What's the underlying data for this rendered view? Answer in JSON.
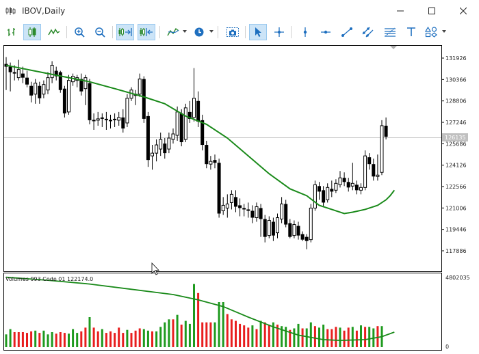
{
  "window": {
    "title": "IBOV,Daily"
  },
  "toolbar": {
    "items": [
      "period-separators",
      "bar-chart",
      "candlestick",
      "line-chart",
      "zoom-in",
      "zoom-out",
      "chart-shift",
      "auto-scroll",
      "indicators",
      "periodicity",
      "screenshot",
      "cursor",
      "crosshair",
      "vertical-line",
      "horizontal-line",
      "trendline",
      "channel",
      "fibonacci",
      "text",
      "shapes"
    ]
  },
  "chart": {
    "y_ticks": [
      "131926",
      "130366",
      "128806",
      "127246",
      "125686",
      "124126",
      "122566",
      "121006",
      "119446",
      "117886"
    ],
    "current_price_label": "126135",
    "candles": [
      [
        131.5,
        131.3,
        132.0,
        129.6
      ],
      [
        131.3,
        130.9,
        131.6,
        129.5
      ],
      [
        130.9,
        130.8,
        131.4,
        130.3
      ],
      [
        130.5,
        131.1,
        131.8,
        130.3
      ],
      [
        130.8,
        130.5,
        131.3,
        130.1
      ],
      [
        130.5,
        130.0,
        131.0,
        129.8
      ],
      [
        129.9,
        129.2,
        130.2,
        128.7
      ],
      [
        129.3,
        130.1,
        130.4,
        128.6
      ],
      [
        129.9,
        129.0,
        130.2,
        128.6
      ],
      [
        129.3,
        130.0,
        130.3,
        129.0
      ],
      [
        129.6,
        130.5,
        130.9,
        129.3
      ],
      [
        130.5,
        131.4,
        131.7,
        130.1
      ],
      [
        131.0,
        130.6,
        131.3,
        130.3
      ],
      [
        130.9,
        129.6,
        131.0,
        129.4
      ],
      [
        129.7,
        127.9,
        129.9,
        127.6
      ],
      [
        128.0,
        130.3,
        130.7,
        127.8
      ],
      [
        130.2,
        130.6,
        130.8,
        129.9
      ],
      [
        130.3,
        130.5,
        130.7,
        129.8
      ],
      [
        130.4,
        129.5,
        130.8,
        129.2
      ],
      [
        129.7,
        130.5,
        130.7,
        128.5
      ],
      [
        130.1,
        127.4,
        130.4,
        127.1
      ],
      [
        127.4,
        127.4,
        127.9,
        126.7
      ],
      [
        127.4,
        127.5,
        128.0,
        127.0
      ],
      [
        127.6,
        127.5,
        127.9,
        126.9
      ],
      [
        127.5,
        127.4,
        128.0,
        126.7
      ],
      [
        127.4,
        127.4,
        127.8,
        126.8
      ],
      [
        127.5,
        127.4,
        127.9,
        126.9
      ],
      [
        127.4,
        127.6,
        128.0,
        127.0
      ],
      [
        127.6,
        126.8,
        128.2,
        126.5
      ],
      [
        127.2,
        129.0,
        129.3,
        126.9
      ],
      [
        129.0,
        129.6,
        129.8,
        128.8
      ],
      [
        129.2,
        129.3,
        129.6,
        128.5
      ],
      [
        129.3,
        130.4,
        130.8,
        129.1
      ],
      [
        130.4,
        127.5,
        130.6,
        127.2
      ],
      [
        127.7,
        124.5,
        128.0,
        124.0
      ],
      [
        124.8,
        125.0,
        125.6,
        123.8
      ],
      [
        125.0,
        125.6,
        126.0,
        124.4
      ],
      [
        125.3,
        126.0,
        126.5,
        124.8
      ],
      [
        125.7,
        125.0,
        126.1,
        124.6
      ],
      [
        125.3,
        126.1,
        126.5,
        125.0
      ],
      [
        126.0,
        126.4,
        126.8,
        125.7
      ],
      [
        126.3,
        128.0,
        128.4,
        125.9
      ],
      [
        127.9,
        125.8,
        128.2,
        125.5
      ],
      [
        126.0,
        128.3,
        128.6,
        125.8
      ],
      [
        128.0,
        127.5,
        128.8,
        127.2
      ],
      [
        127.6,
        129.0,
        131.2,
        127.3
      ],
      [
        128.8,
        127.3,
        129.5,
        126.9
      ],
      [
        127.4,
        125.6,
        127.8,
        125.2
      ],
      [
        125.6,
        124.2,
        125.9,
        123.9
      ],
      [
        124.2,
        124.4,
        124.8,
        123.8
      ],
      [
        124.5,
        124.3,
        124.9,
        123.9
      ],
      [
        124.3,
        120.6,
        124.6,
        120.3
      ],
      [
        120.8,
        121.2,
        121.8,
        120.5
      ],
      [
        121.0,
        121.3,
        122.0,
        120.3
      ],
      [
        121.4,
        122.0,
        122.3,
        120.9
      ],
      [
        121.8,
        121.1,
        122.3,
        120.7
      ],
      [
        121.2,
        121.0,
        121.7,
        120.4
      ],
      [
        121.0,
        120.9,
        121.3,
        120.4
      ],
      [
        120.9,
        120.8,
        121.4,
        120.3
      ],
      [
        120.8,
        120.3,
        121.2,
        119.9
      ],
      [
        120.3,
        121.1,
        121.4,
        120.0
      ],
      [
        121.0,
        120.2,
        121.3,
        118.9
      ],
      [
        120.2,
        118.9,
        120.5,
        118.5
      ],
      [
        119.0,
        120.1,
        120.4,
        118.8
      ],
      [
        120.0,
        119.0,
        120.3,
        118.6
      ],
      [
        119.2,
        120.3,
        120.6,
        118.8
      ],
      [
        120.2,
        121.3,
        121.8,
        119.9
      ],
      [
        121.3,
        119.8,
        121.6,
        119.6
      ],
      [
        119.9,
        118.9,
        120.2,
        118.8
      ],
      [
        119.0,
        119.8,
        120.1,
        118.8
      ],
      [
        119.7,
        119.0,
        120.0,
        118.7
      ],
      [
        119.1,
        118.7,
        119.3,
        118.6
      ],
      [
        118.9,
        118.6,
        119.1,
        118.0
      ],
      [
        118.7,
        121.0,
        121.3,
        118.5
      ],
      [
        121.0,
        122.7,
        123.0,
        120.8
      ],
      [
        122.6,
        122.2,
        122.9,
        121.6
      ],
      [
        122.3,
        121.4,
        122.6,
        121.1
      ],
      [
        121.6,
        122.5,
        122.8,
        121.4
      ],
      [
        122.4,
        122.2,
        123.0,
        121.8
      ],
      [
        122.3,
        122.8,
        123.1,
        122.1
      ],
      [
        122.7,
        123.2,
        123.7,
        122.5
      ],
      [
        123.2,
        122.9,
        123.6,
        122.6
      ],
      [
        122.9,
        122.5,
        123.2,
        122.2
      ],
      [
        122.6,
        122.8,
        124.3,
        122.3
      ],
      [
        122.7,
        122.3,
        123.0,
        122.0
      ],
      [
        122.3,
        122.5,
        122.8,
        122.0
      ],
      [
        122.5,
        124.8,
        125.2,
        122.3
      ],
      [
        124.7,
        124.2,
        125.0,
        123.8
      ],
      [
        124.2,
        123.3,
        124.6,
        123.0
      ],
      [
        123.3,
        123.4,
        124.9,
        123.0
      ],
      [
        123.6,
        127.0,
        127.4,
        123.4
      ],
      [
        127.0,
        126.2,
        127.6,
        126.0
      ]
    ],
    "ma": [
      [
        0,
        131.4
      ],
      [
        10,
        130.8
      ],
      [
        20,
        130.2
      ],
      [
        26,
        129.7
      ],
      [
        33,
        129.1
      ],
      [
        38,
        128.6
      ],
      [
        43,
        127.7
      ],
      [
        48,
        127.1
      ],
      [
        53,
        126.1
      ],
      [
        58,
        124.8
      ],
      [
        63,
        123.5
      ],
      [
        68,
        122.4
      ],
      [
        72,
        121.9
      ],
      [
        75,
        121.2
      ],
      [
        78,
        120.9
      ],
      [
        81,
        120.6
      ],
      [
        83,
        120.7
      ],
      [
        86,
        120.9
      ],
      [
        89,
        121.2
      ],
      [
        90,
        121.4
      ],
      [
        91,
        121.6
      ],
      [
        92,
        121.9
      ],
      [
        93,
        122.3
      ]
    ]
  },
  "volume": {
    "label": "Volumes 993 Code 01 122174.0",
    "top_label": "4802035",
    "bottom_label": "0",
    "bars": [
      {
        "c": "g",
        "h": 0.17
      },
      {
        "c": "g",
        "h": 0.24
      },
      {
        "c": "r",
        "h": 0.2
      },
      {
        "c": "r",
        "h": 0.2
      },
      {
        "c": "r",
        "h": 0.2
      },
      {
        "c": "r",
        "h": 0.19
      },
      {
        "c": "r",
        "h": 0.21
      },
      {
        "c": "g",
        "h": 0.22
      },
      {
        "c": "r",
        "h": 0.19
      },
      {
        "c": "g",
        "h": 0.22
      },
      {
        "c": "g",
        "h": 0.17
      },
      {
        "c": "g",
        "h": 0.2
      },
      {
        "c": "r",
        "h": 0.18
      },
      {
        "c": "r",
        "h": 0.2
      },
      {
        "c": "r",
        "h": 0.19
      },
      {
        "c": "g",
        "h": 0.18
      },
      {
        "c": "g",
        "h": 0.24
      },
      {
        "c": "g",
        "h": 0.19
      },
      {
        "c": "r",
        "h": 0.21
      },
      {
        "c": "r",
        "h": 0.26
      },
      {
        "c": "g",
        "h": 0.4
      },
      {
        "c": "r",
        "h": 0.26
      },
      {
        "c": "r",
        "h": 0.21
      },
      {
        "c": "g",
        "h": 0.24
      },
      {
        "c": "r",
        "h": 0.19
      },
      {
        "c": "r",
        "h": 0.21
      },
      {
        "c": "r",
        "h": 0.19
      },
      {
        "c": "r",
        "h": 0.26
      },
      {
        "c": "r",
        "h": 0.19
      },
      {
        "c": "g",
        "h": 0.23
      },
      {
        "c": "r",
        "h": 0.19
      },
      {
        "c": "r",
        "h": 0.22
      },
      {
        "c": "r",
        "h": 0.25
      },
      {
        "c": "g",
        "h": 0.24
      },
      {
        "c": "g",
        "h": 0.22
      },
      {
        "c": "r",
        "h": 0.21
      },
      {
        "c": "g",
        "h": 0.21
      },
      {
        "c": "g",
        "h": 0.27
      },
      {
        "c": "g",
        "h": 0.33
      },
      {
        "c": "g",
        "h": 0.37
      },
      {
        "c": "r",
        "h": 0.37
      },
      {
        "c": "g",
        "h": 0.43
      },
      {
        "c": "r",
        "h": 0.3
      },
      {
        "c": "g",
        "h": 0.35
      },
      {
        "c": "g",
        "h": 0.31
      },
      {
        "c": "g",
        "h": 0.84
      },
      {
        "c": "r",
        "h": 0.72
      },
      {
        "c": "r",
        "h": 0.33
      },
      {
        "c": "r",
        "h": 0.33
      },
      {
        "c": "r",
        "h": 0.33
      },
      {
        "c": "g",
        "h": 0.33
      },
      {
        "c": "g",
        "h": 0.6
      },
      {
        "c": "g",
        "h": 0.6
      },
      {
        "c": "r",
        "h": 0.44
      },
      {
        "c": "r",
        "h": 0.37
      },
      {
        "c": "r",
        "h": 0.35
      },
      {
        "c": "r",
        "h": 0.31
      },
      {
        "c": "r",
        "h": 0.29
      },
      {
        "c": "r",
        "h": 0.26
      },
      {
        "c": "g",
        "h": 0.29
      },
      {
        "c": "r",
        "h": 0.24
      },
      {
        "c": "g",
        "h": 0.35
      },
      {
        "c": "r",
        "h": 0.33
      },
      {
        "c": "r",
        "h": 0.3
      },
      {
        "c": "g",
        "h": 0.33
      },
      {
        "c": "r",
        "h": 0.3
      },
      {
        "c": "g",
        "h": 0.28
      },
      {
        "c": "g",
        "h": 0.27
      },
      {
        "c": "r",
        "h": 0.23
      },
      {
        "c": "g",
        "h": 0.25
      },
      {
        "c": "g",
        "h": 0.31
      },
      {
        "c": "r",
        "h": 0.25
      },
      {
        "c": "g",
        "h": 0.25
      },
      {
        "c": "g",
        "h": 0.33
      },
      {
        "c": "r",
        "h": 0.28
      },
      {
        "c": "g",
        "h": 0.26
      },
      {
        "c": "g",
        "h": 0.3
      },
      {
        "c": "r",
        "h": 0.24
      },
      {
        "c": "r",
        "h": 0.24
      },
      {
        "c": "r",
        "h": 0.27
      },
      {
        "c": "g",
        "h": 0.26
      },
      {
        "c": "r",
        "h": 0.22
      },
      {
        "c": "r",
        "h": 0.26
      },
      {
        "c": "g",
        "h": 0.27
      },
      {
        "c": "r",
        "h": 0.22
      },
      {
        "c": "g",
        "h": 0.29
      },
      {
        "c": "r",
        "h": 0.27
      },
      {
        "c": "g",
        "h": 0.27
      },
      {
        "c": "g",
        "h": 0.25
      },
      {
        "c": "r",
        "h": 0.28
      },
      {
        "c": "g",
        "h": 0.28
      }
    ],
    "ma": [
      [
        0,
        0.93
      ],
      [
        10,
        0.89
      ],
      [
        20,
        0.84
      ],
      [
        30,
        0.77
      ],
      [
        40,
        0.7
      ],
      [
        46,
        0.63
      ],
      [
        52,
        0.54
      ],
      [
        58,
        0.4
      ],
      [
        64,
        0.27
      ],
      [
        70,
        0.16
      ],
      [
        76,
        0.1
      ],
      [
        80,
        0.09
      ],
      [
        86,
        0.1
      ],
      [
        90,
        0.14
      ],
      [
        93,
        0.2
      ]
    ]
  }
}
